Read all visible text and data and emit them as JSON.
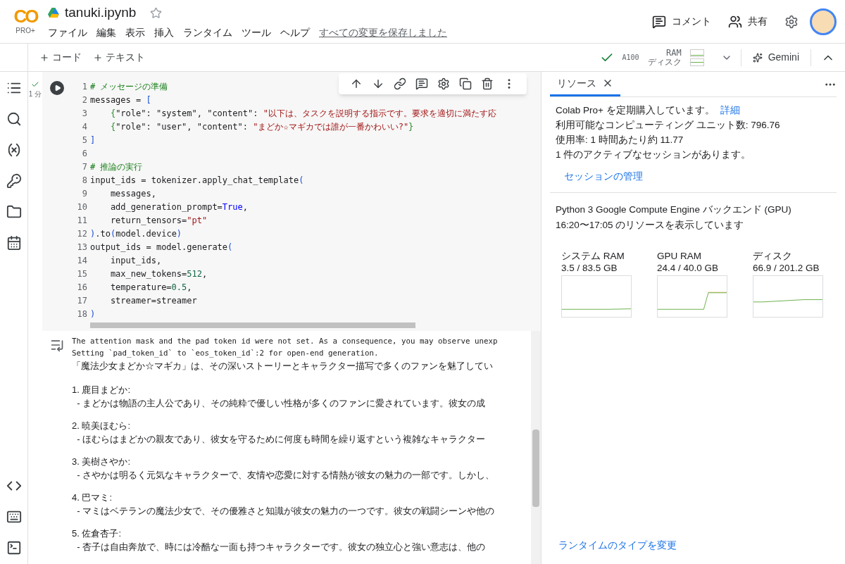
{
  "header": {
    "logo": "CO",
    "logo_badge": "PRO+",
    "file_name": "tanuki.ipynb",
    "starred": false,
    "menu": [
      "ファイル",
      "編集",
      "表示",
      "挿入",
      "ランタイム",
      "ツール",
      "ヘルプ"
    ],
    "save_status": "すべての変更を保存しました",
    "actions": [
      {
        "kind": "comment",
        "label": "コメント"
      },
      {
        "kind": "share",
        "label": "共有"
      }
    ]
  },
  "toolbar": {
    "add_buttons": [
      "コード",
      "テキスト"
    ],
    "runtime": {
      "connected": true,
      "gpu": "A100",
      "ram_label": "RAM",
      "disk_label": "ディスク"
    },
    "gemini": "Gemini"
  },
  "cell": {
    "exec_time": "1 分",
    "done": true,
    "lines": [
      {
        "no": "1",
        "tokens": [
          {
            "kind": "comment",
            "text": "# メッセージの準備"
          }
        ]
      },
      {
        "no": "2",
        "tokens": [
          {
            "kind": "plain",
            "text": "messages = "
          },
          {
            "kind": "bracket",
            "text": "["
          }
        ]
      },
      {
        "no": "3",
        "tokens": [
          {
            "kind": "brace",
            "text": "    {"
          },
          {
            "kind": "plain",
            "text": "\"role\": \"system\", \"content\": "
          },
          {
            "kind": "string",
            "text": "\"以下は、タスクを説明する指示です。要求を適切に満たす応"
          }
        ]
      },
      {
        "no": "4",
        "tokens": [
          {
            "kind": "brace",
            "text": "    {"
          },
          {
            "kind": "plain",
            "text": "\"role\": \"user\", \"content\": "
          },
          {
            "kind": "string",
            "text": "\"まどか☆マギカでは誰が一番かわいい?\""
          },
          {
            "kind": "brace",
            "text": "}"
          }
        ]
      },
      {
        "no": "5",
        "tokens": [
          {
            "kind": "bracket",
            "text": "]"
          }
        ]
      },
      {
        "no": "6"
      },
      {
        "no": "7",
        "tokens": [
          {
            "kind": "comment",
            "text": "# 推論の実行"
          }
        ]
      },
      {
        "no": "8",
        "tokens": [
          {
            "kind": "plain",
            "text": "input_ids = tokenizer.apply_chat_template"
          },
          {
            "kind": "bracket",
            "text": "("
          }
        ]
      },
      {
        "no": "9",
        "tokens": [
          {
            "kind": "plain",
            "text": "    messages,"
          }
        ]
      },
      {
        "no": "10",
        "tokens": [
          {
            "kind": "plain",
            "text": "    add_generation_prompt="
          },
          {
            "kind": "keyword",
            "text": "True"
          },
          {
            "kind": "plain",
            "text": ","
          }
        ]
      },
      {
        "no": "11",
        "tokens": [
          {
            "kind": "plain",
            "text": "    return_tensors="
          },
          {
            "kind": "string",
            "text": "\"pt\""
          }
        ]
      },
      {
        "no": "12",
        "tokens": [
          {
            "kind": "bracket",
            "text": ")"
          },
          {
            "kind": "plain",
            "text": ".to"
          },
          {
            "kind": "bracket",
            "text": "("
          },
          {
            "kind": "plain",
            "text": "model.device"
          },
          {
            "kind": "bracket",
            "text": ")"
          }
        ]
      },
      {
        "no": "13",
        "tokens": [
          {
            "kind": "plain",
            "text": "output_ids = model.generate"
          },
          {
            "kind": "bracket",
            "text": "("
          }
        ]
      },
      {
        "no": "14",
        "tokens": [
          {
            "kind": "plain",
            "text": "    input_ids,"
          }
        ]
      },
      {
        "no": "15",
        "tokens": [
          {
            "kind": "plain",
            "text": "    max_new_tokens="
          },
          {
            "kind": "number",
            "text": "512"
          },
          {
            "kind": "plain",
            "text": ","
          }
        ]
      },
      {
        "no": "16",
        "tokens": [
          {
            "kind": "plain",
            "text": "    temperature="
          },
          {
            "kind": "number",
            "text": "0.5"
          },
          {
            "kind": "plain",
            "text": ","
          }
        ]
      },
      {
        "no": "17",
        "tokens": [
          {
            "kind": "plain",
            "text": "    streamer=streamer"
          }
        ]
      },
      {
        "no": "18",
        "tokens": [
          {
            "kind": "bracket",
            "text": ")"
          }
        ]
      }
    ],
    "output": {
      "log": [
        "The attention mask and the pad token id were not set. As a consequence, you may observe unexp",
        "Setting `pad_token_id` to `eos_token_id`:2 for open-end generation."
      ],
      "intro": "「魔法少女まどか☆マギカ」は、その深いストーリーとキャラクター描写で多くのファンを魅了してい",
      "items": [
        {
          "heading": "1. 鹿目まどか:",
          "detail": "  - まどかは物語の主人公であり、その純粋で優しい性格が多くのファンに愛されています。彼女の成"
        },
        {
          "heading": "2. 暁美ほむら:",
          "detail": "  - ほむらはまどかの親友であり、彼女を守るために何度も時間を繰り返すという複雑なキャラクター"
        },
        {
          "heading": "3. 美樹さやか:",
          "detail": "  - さやかは明るく元気なキャラクターで、友情や恋愛に対する情熱が彼女の魅力の一部です。しかし、"
        },
        {
          "heading": "4. 巴マミ:",
          "detail": "  - マミはベテランの魔法少女で、その優雅さと知識が彼女の魅力の一つです。彼女の戦闘シーンや他の"
        },
        {
          "heading": "5. 佐倉杏子:",
          "detail": "  - 杏子は自由奔放で、時には冷酷な一面も持つキャラクターです。彼女の独立心と強い意志は、他の"
        }
      ]
    }
  },
  "panel": {
    "tabs": [
      {
        "label": "リソース",
        "selected": true
      }
    ],
    "plan": "Colab Pro+ を定期購入しています。",
    "plan_link": "詳細",
    "info": [
      "利用可能なコンピューティング ユニット数: 796.76",
      "使用率: 1 時間あたり約 11.77",
      "1 件のアクティブなセッションがあります。"
    ],
    "manage_link": "セッションの管理",
    "backend": "Python 3 Google Compute Engine バックエンド (GPU)",
    "range": "16:20〜17:05 のリソースを表示しています",
    "meters": [
      {
        "kind": "ram",
        "label": "システム RAM",
        "usage": "3.5 / 83.5 GB"
      },
      {
        "kind": "gpu",
        "label": "GPU RAM",
        "usage": "24.4 / 40.0 GB"
      },
      {
        "kind": "disk",
        "label": "ディスク",
        "usage": "66.9 / 201.2 GB"
      }
    ],
    "footer_link": "ランタイムのタイプを変更"
  }
}
